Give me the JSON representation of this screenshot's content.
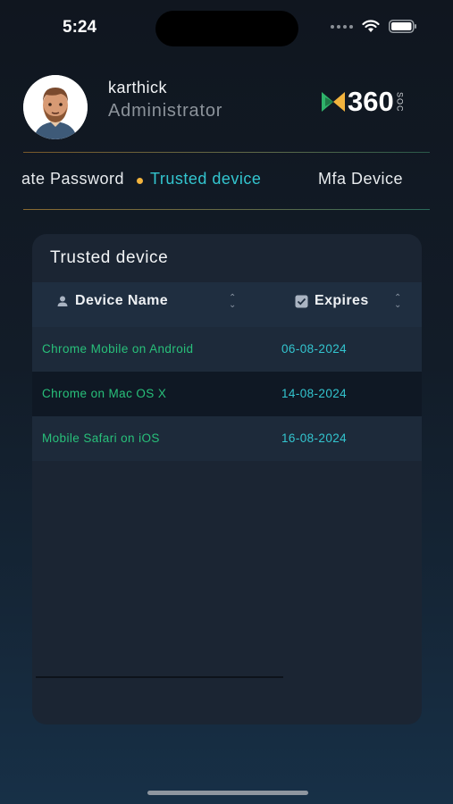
{
  "status_bar": {
    "time": "5:24"
  },
  "profile": {
    "name": "karthick",
    "role": "Administrator"
  },
  "brand": {
    "logo_text": "360",
    "logo_sub": "SOC"
  },
  "tabs": [
    {
      "label": "ate Password",
      "active": false
    },
    {
      "label": "Trusted device",
      "active": true
    },
    {
      "label": "Mfa Device",
      "active": false
    }
  ],
  "card": {
    "title": "Trusted device",
    "columns": [
      {
        "label": "Device Name",
        "icon": "user-icon"
      },
      {
        "label": "Expires",
        "icon": "checkbox-icon"
      }
    ],
    "rows": [
      {
        "device": "Chrome Mobile on Android",
        "expires": "06-08-2024"
      },
      {
        "device": "Chrome on Mac OS X",
        "expires": "14-08-2024"
      },
      {
        "device": "Mobile Safari on iOS",
        "expires": "16-08-2024"
      }
    ]
  },
  "colors": {
    "accent_cyan": "#33c5cf",
    "accent_green": "#28c07a",
    "active_dot": "#f2b33d"
  }
}
